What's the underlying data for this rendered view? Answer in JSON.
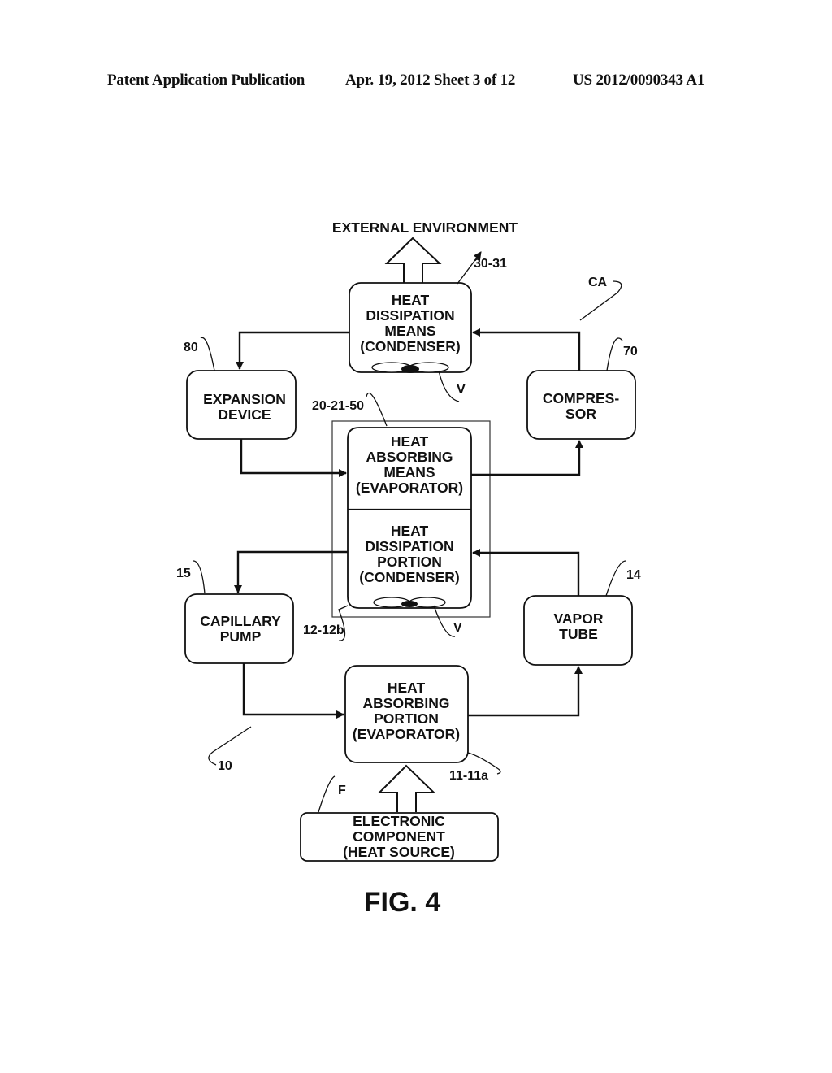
{
  "header": {
    "left": "Patent Application Publication",
    "middle": "Apr. 19, 2012  Sheet 3 of 12",
    "right": "US 2012/0090343 A1"
  },
  "figure": {
    "title": "FIG. 4",
    "external_environment": "EXTERNAL ENVIRONMENT",
    "blocks": {
      "condenser_top": [
        "HEAT",
        "DISSIPATION",
        "MEANS",
        "(CONDENSER)"
      ],
      "expansion": [
        "EXPANSION",
        "DEVICE"
      ],
      "compressor": [
        "COMPRES-",
        "SOR"
      ],
      "evap_means": [
        "HEAT",
        "ABSORBING",
        "MEANS",
        "(EVAPORATOR)"
      ],
      "diss_portion": [
        "HEAT",
        "DISSIPATION",
        "PORTION",
        "(CONDENSER)"
      ],
      "capillary": [
        "CAPILLARY",
        "PUMP"
      ],
      "vapor": [
        "VAPOR",
        "TUBE"
      ],
      "abs_portion": [
        "HEAT",
        "ABSORBING",
        "PORTION",
        "(EVAPORATOR)"
      ],
      "electronic": [
        "ELECTRONIC",
        "COMPONENT",
        "(HEAT SOURCE)"
      ]
    },
    "refs": {
      "r30": "30-31",
      "rCA": "CA",
      "r80": "80",
      "r70": "70",
      "rV1": "V",
      "r20": "20-21-50",
      "r15": "15",
      "r14": "14",
      "r12": "12-12b",
      "rV2": "V",
      "r10": "10",
      "r11": "11-11a",
      "rF": "F"
    }
  }
}
